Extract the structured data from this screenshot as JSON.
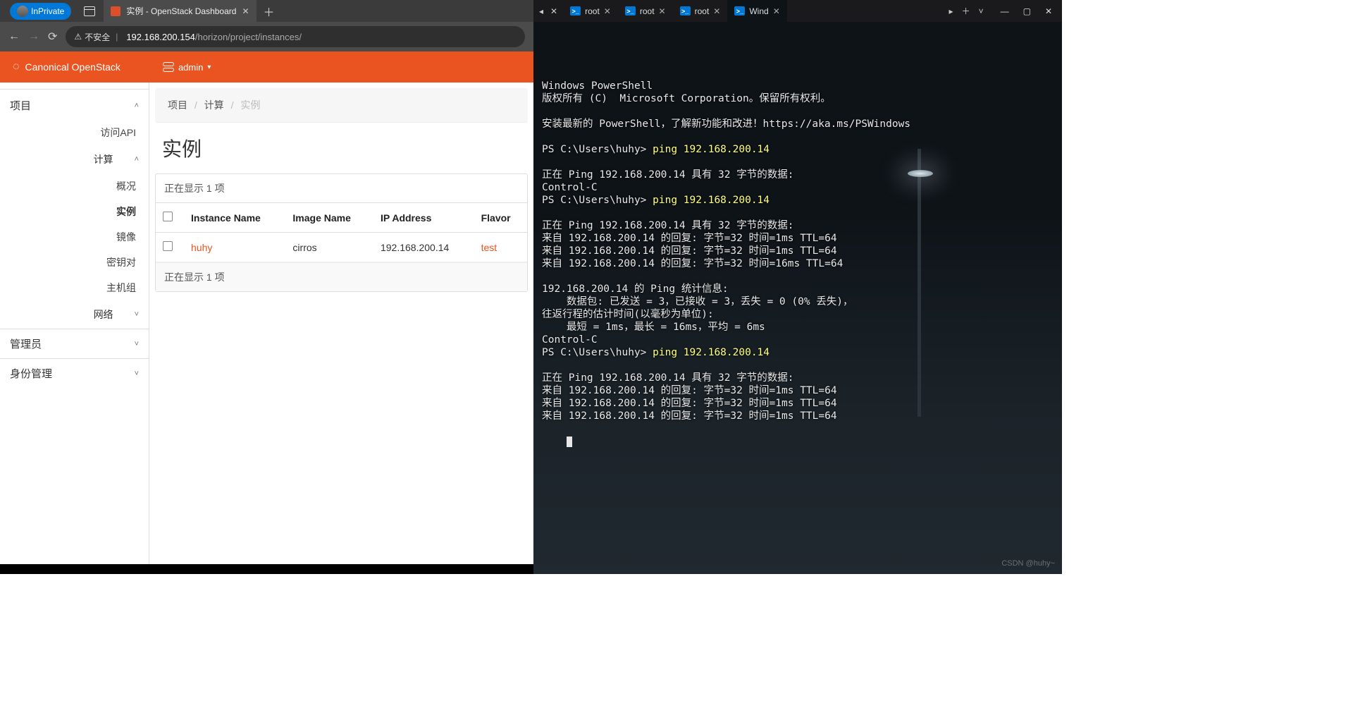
{
  "browser": {
    "inprivate_label": "InPrivate",
    "tab_title": "实例 - OpenStack Dashboard",
    "insecure_label": "不安全",
    "url_host": "192.168.200.154",
    "url_path": "/horizon/project/instances/"
  },
  "openstack": {
    "brand": "Canonical OpenStack",
    "project_label": "admin",
    "sidebar": {
      "project": "项目",
      "api": "访问API",
      "compute": "计算",
      "overview": "概况",
      "instances": "实例",
      "images": "镜像",
      "keypairs": "密钥对",
      "hostgroups": "主机组",
      "network": "网络",
      "admin": "管理员",
      "identity": "身份管理"
    },
    "breadcrumb": {
      "a": "项目",
      "b": "计算",
      "c": "实例"
    },
    "page_title": "实例",
    "table_caption_top": "正在显示 1 项",
    "table_caption_bottom": "正在显示 1 项",
    "columns": {
      "name": "Instance Name",
      "image": "Image Name",
      "ip": "IP Address",
      "flavor": "Flavor"
    },
    "rows": [
      {
        "name": "huhy",
        "image": "cirros",
        "ip": "192.168.200.14",
        "flavor": "test"
      }
    ]
  },
  "terminal": {
    "tabs": [
      {
        "label": "root"
      },
      {
        "label": "root"
      },
      {
        "label": "root"
      },
      {
        "label": "Wind"
      }
    ],
    "active_tab_index": 3,
    "lines": [
      "Windows PowerShell",
      "版权所有 (C)  Microsoft Corporation。保留所有权利。",
      "",
      "安装最新的 PowerShell，了解新功能和改进！https://aka.ms/PSWindows",
      "",
      {
        "prompt": "PS C:\\Users\\huhy> ",
        "cmd": "ping 192.168.200.14"
      },
      "",
      "正在 Ping 192.168.200.14 具有 32 字节的数据:",
      "Control-C",
      {
        "prompt": "PS C:\\Users\\huhy> ",
        "cmd": "ping 192.168.200.14"
      },
      "",
      "正在 Ping 192.168.200.14 具有 32 字节的数据:",
      "来自 192.168.200.14 的回复: 字节=32 时间=1ms TTL=64",
      "来自 192.168.200.14 的回复: 字节=32 时间=1ms TTL=64",
      "来自 192.168.200.14 的回复: 字节=32 时间=16ms TTL=64",
      "",
      "192.168.200.14 的 Ping 统计信息:",
      "    数据包: 已发送 = 3，已接收 = 3，丢失 = 0 (0% 丢失)，",
      "往返行程的估计时间(以毫秒为单位):",
      "    最短 = 1ms，最长 = 16ms，平均 = 6ms",
      "Control-C",
      {
        "prompt": "PS C:\\Users\\huhy> ",
        "cmd": "ping 192.168.200.14"
      },
      "",
      "正在 Ping 192.168.200.14 具有 32 字节的数据:",
      "来自 192.168.200.14 的回复: 字节=32 时间=1ms TTL=64",
      "来自 192.168.200.14 的回复: 字节=32 时间=1ms TTL=64",
      "来自 192.168.200.14 的回复: 字节=32 时间=1ms TTL=64"
    ],
    "watermark": "CSDN @huhy~"
  }
}
